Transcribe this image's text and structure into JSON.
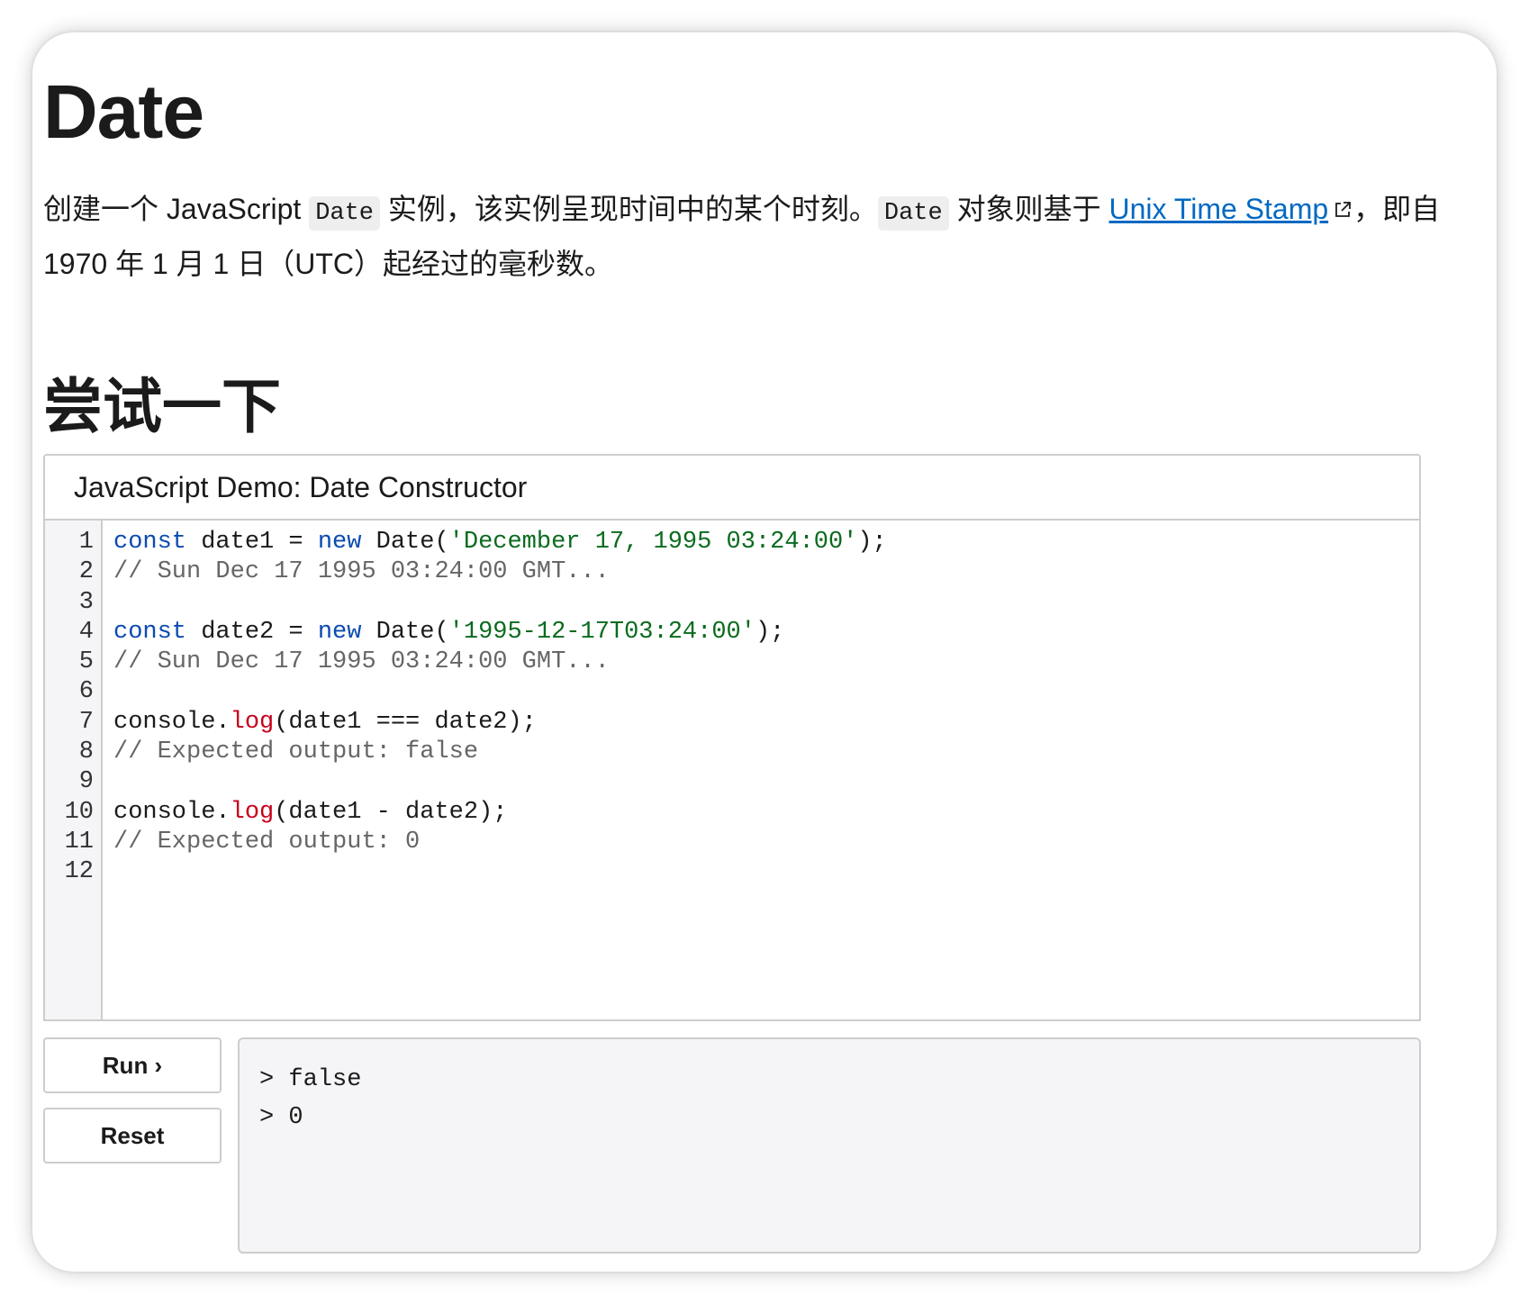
{
  "page": {
    "title": "Date",
    "intro": {
      "part1": "创建一个 JavaScript ",
      "code1": "Date",
      "part2": " 实例，该实例呈现时间中的某个时刻。",
      "code2": "Date",
      "part3": " 对象则基于 ",
      "link_text": "Unix Time Stamp",
      "part4": "，即自 1970 年 1 月 1 日（UTC）起经过的毫秒数。"
    },
    "section_heading": "尝试一下"
  },
  "demo": {
    "title": "JavaScript Demo: Date Constructor",
    "line_numbers": [
      "1",
      "2",
      "3",
      "4",
      "5",
      "6",
      "7",
      "8",
      "9",
      "10",
      "11",
      "12"
    ],
    "code": {
      "l1": {
        "kw1": "const",
        "t1": " date1 = ",
        "kw2": "new",
        "t2": " Date(",
        "str": "'December 17, 1995 03:24:00'",
        "t3": ");"
      },
      "l2": {
        "cmt": "// Sun Dec 17 1995 03:24:00 GMT..."
      },
      "l4": {
        "kw1": "const",
        "t1": " date2 = ",
        "kw2": "new",
        "t2": " Date(",
        "str": "'1995-12-17T03:24:00'",
        "t3": ");"
      },
      "l5": {
        "cmt": "// Sun Dec 17 1995 03:24:00 GMT..."
      },
      "l7": {
        "t1": "console.",
        "fn": "log",
        "t2": "(date1 === date2);"
      },
      "l8": {
        "cmt": "// Expected output: false"
      },
      "l10": {
        "t1": "console.",
        "fn": "log",
        "t2": "(date1 - date2);"
      },
      "l11": {
        "cmt": "// Expected output: 0"
      }
    },
    "run_label": "Run ›",
    "reset_label": "Reset",
    "console_output": [
      "> false",
      "> 0"
    ]
  },
  "colors": {
    "keyword": "#0b4bb0",
    "string": "#0a6b1e",
    "comment": "#666666",
    "function": "#c7001b",
    "link": "#0069c2"
  },
  "icons": {
    "external_link": "external-link-icon"
  }
}
